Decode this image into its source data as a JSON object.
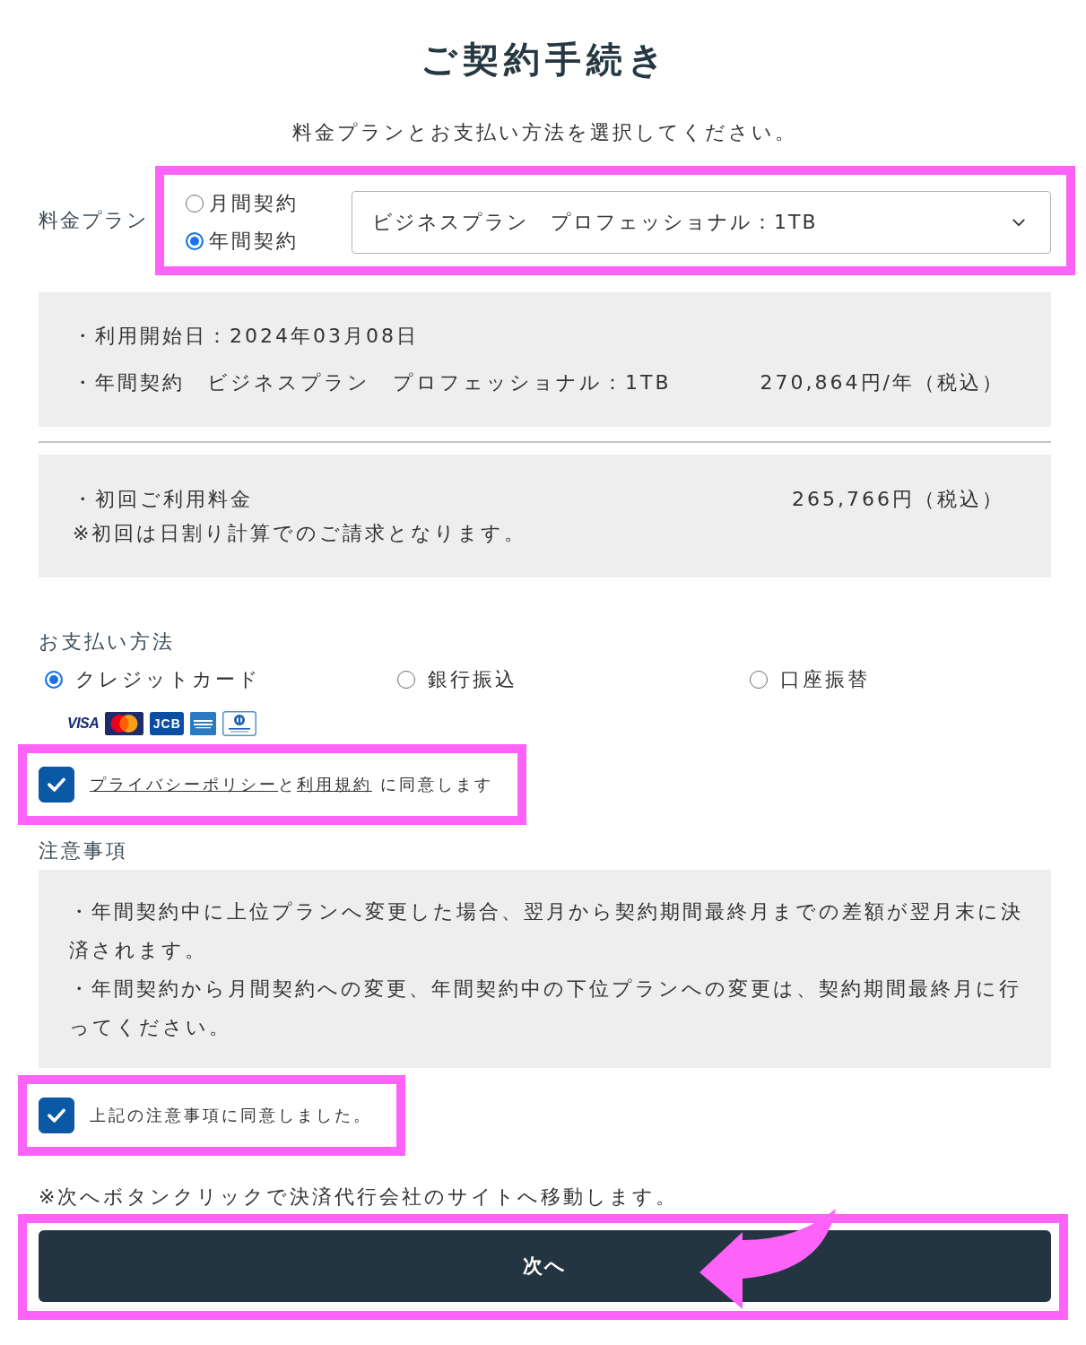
{
  "title": "ご契約手続き",
  "subtitle": "料金プランとお支払い方法を選択してください。",
  "plan": {
    "label": "料金プラン",
    "highlighted": true,
    "terms": [
      {
        "label": "月間契約",
        "selected": false
      },
      {
        "label": "年間契約",
        "selected": true
      }
    ],
    "select": {
      "value": "ビジネスプラン　プロフェッショナル：1TB"
    }
  },
  "summary": {
    "lines": [
      {
        "text": "・利用開始日：2024年03月08日"
      },
      {
        "text": "・年間契約　ビジネスプラン　プロフェッショナル：1TB",
        "amount": "270,864円/年（税込）"
      }
    ]
  },
  "first_charge": {
    "label": "・初回ご利用料金",
    "amount": "265,766円（税込）",
    "note": "※初回は日割り計算でのご請求となります。"
  },
  "payment": {
    "label": "お支払い方法",
    "methods": [
      {
        "label": "クレジットカード",
        "selected": true
      },
      {
        "label": "銀行振込",
        "selected": false
      },
      {
        "label": "口座振替",
        "selected": false
      }
    ],
    "card_logos": [
      {
        "kind": "visa",
        "text": "VISA"
      },
      {
        "kind": "mastercard"
      },
      {
        "kind": "jcb",
        "text": "JCB"
      },
      {
        "kind": "amex"
      },
      {
        "kind": "diners"
      }
    ]
  },
  "privacy_agreement": {
    "checked": true,
    "highlighted": true,
    "parts": [
      {
        "kind": "link",
        "text": "プライバシーポリシー"
      },
      {
        "kind": "text",
        "text": "と"
      },
      {
        "kind": "link",
        "text": "利用規約"
      },
      {
        "kind": "text",
        "text": " に同意します"
      }
    ]
  },
  "notices": {
    "label": "注意事項",
    "items": [
      "・年間契約中に上位プランへ変更した場合、翌月から契約期間最終月までの差額が翌月末に決済されます。",
      "・年間契約から月間契約への変更、年間契約中の下位プランへの変更は、契約期間最終月に行ってください。"
    ]
  },
  "notice_agreement": {
    "checked": true,
    "highlighted": true,
    "label": "上記の注意事項に同意しました。"
  },
  "redirect_note": "※次へボタンクリックで決済代行会社のサイトへ移動します。",
  "next_button": {
    "label": "次へ",
    "highlighted": true,
    "arrow": true
  }
}
